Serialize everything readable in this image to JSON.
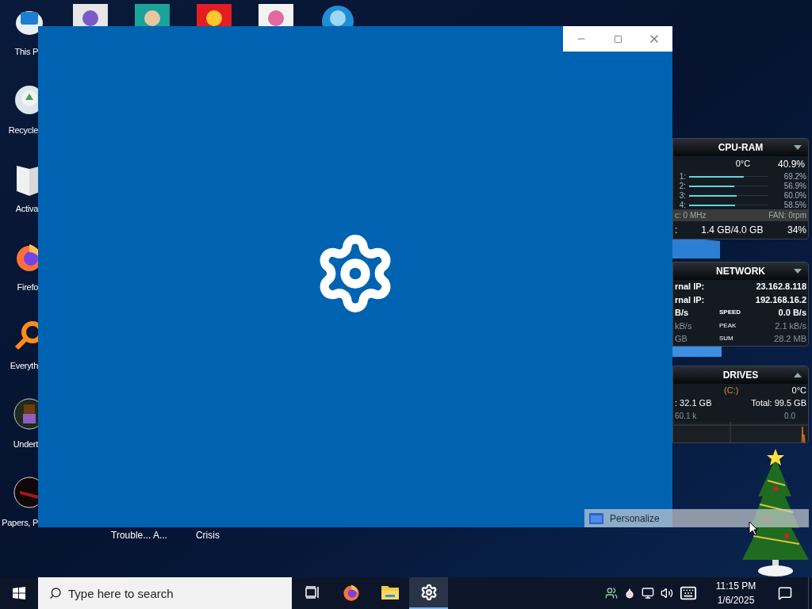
{
  "desktop_icons": [
    {
      "label": "This P",
      "kind": "computer"
    },
    {
      "label": "Recycle",
      "kind": "recycle"
    },
    {
      "label": "Activa",
      "kind": "folder"
    },
    {
      "label": "Firefo",
      "kind": "firefox"
    },
    {
      "label": "Everyth",
      "kind": "search"
    },
    {
      "label": "Undert",
      "kind": "game"
    },
    {
      "label": "Papers, P",
      "kind": "game-dark"
    }
  ],
  "hidden_icon_labels": [
    "Trouble... A...",
    "Crisis"
  ],
  "settings_window": {
    "controls": [
      {
        "kind": "minimize"
      },
      {
        "kind": "maximize"
      },
      {
        "kind": "close"
      }
    ]
  },
  "cpu_ram": {
    "title": "CPU-RAM",
    "expanded": false,
    "temperature": "0°C",
    "total": "40.9%",
    "cores": [
      {
        "label": "1:",
        "value": "69.2%",
        "level": 0.69
      },
      {
        "label": "2:",
        "value": "56.9%",
        "level": 0.57
      },
      {
        "label": "3:",
        "value": "60.0%",
        "level": 0.6
      },
      {
        "label": "4:",
        "value": "58.5%",
        "level": 0.58
      }
    ],
    "frequency": "c: 0 MHz",
    "fan": "FAN: 0rpm",
    "ram_label": ":",
    "ram": "1.4 GB/4.0 GB",
    "ram_percent": "34%"
  },
  "network": {
    "title": "NETWORK",
    "expanded": false,
    "ips": [
      {
        "label": "rnal IP:",
        "value": "23.162.8.118"
      },
      {
        "label": "rnal IP:",
        "value": "192.168.16.2"
      }
    ],
    "stats": [
      {
        "left": "B/s",
        "label": "SPEED",
        "value": "0.0 B/s"
      },
      {
        "left": "kB/s",
        "label": "PEAK",
        "value": "2.1 kB/s"
      },
      {
        "left": "GB",
        "label": "SUM",
        "value": "28.2 MB"
      }
    ]
  },
  "drives": {
    "title": "DRIVES",
    "expanded": true,
    "drive": "(C:)",
    "temperature": "0°C",
    "free": ": 32.1 GB",
    "total": "Total: 99.5 GB",
    "read": "60.1 k",
    "write": "0.0"
  },
  "context_item": {
    "label": "Personalize"
  },
  "taskbar": {
    "search": {
      "placeholder": "Type here to search"
    },
    "apps": [
      {
        "kind": "task-view",
        "active": false
      },
      {
        "kind": "firefox",
        "active": false
      },
      {
        "kind": "explorer",
        "active": false
      },
      {
        "kind": "settings",
        "active": true
      }
    ],
    "tray": [
      {
        "kind": "people"
      },
      {
        "kind": "drop"
      },
      {
        "kind": "network"
      },
      {
        "kind": "volume"
      },
      {
        "kind": "keyboard"
      }
    ],
    "time": "11:15 PM",
    "date": "1/6/2025"
  }
}
